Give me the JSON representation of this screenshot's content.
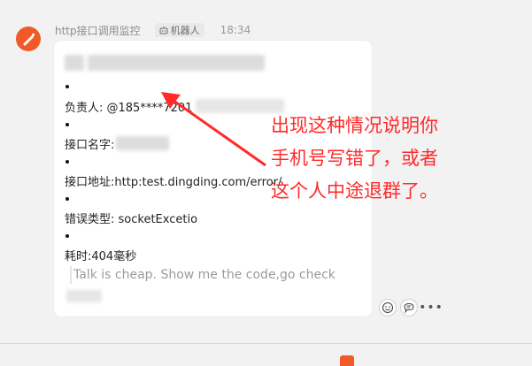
{
  "header": {
    "sender": "http接口调用监控",
    "bot_badge": "机器人",
    "time": "18:34"
  },
  "message": {
    "owner_label": "负责人: @185****7201",
    "name_label": "接口名字:",
    "address_label": "接口地址:http:test.dingding.com/error/",
    "error_label": "错误类型: socketExcetio",
    "duration_label": "耗时:404毫秒",
    "quote": "Talk is cheap. Show me the code,go check"
  },
  "annotation": {
    "line1": "出现这种情况说明你",
    "line2": "手机号写错了，或者",
    "line3": "这个人中途退群了。",
    "color": "#ff2a2a"
  },
  "actions": {
    "emoji_icon": "emoji-icon",
    "reply_icon": "reply-icon",
    "more_label": "•••"
  },
  "colors": {
    "avatar": "#f05a28",
    "background": "#f2f2f3",
    "bubble": "#ffffff"
  }
}
